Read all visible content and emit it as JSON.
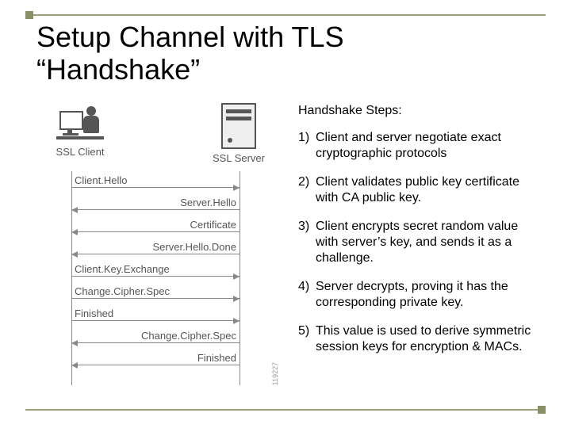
{
  "title_line1": "Setup Channel with TLS",
  "title_line2": "“Handshake”",
  "diagram": {
    "client_label": "SSL Client",
    "server_label": "SSL Server",
    "side_id": "119227",
    "messages": [
      {
        "dir": "right",
        "label": "Client.Hello"
      },
      {
        "dir": "left",
        "label": "Server.Hello"
      },
      {
        "dir": "left",
        "label": "Certificate"
      },
      {
        "dir": "left",
        "label": "Server.Hello.Done"
      },
      {
        "dir": "right",
        "label": "Client.Key.Exchange"
      },
      {
        "dir": "right",
        "label": "Change.Cipher.Spec"
      },
      {
        "dir": "right",
        "label": "Finished"
      },
      {
        "dir": "left",
        "label": "Change.Cipher.Spec"
      },
      {
        "dir": "left",
        "label": "Finished"
      }
    ]
  },
  "steps_title": "Handshake Steps:",
  "steps": [
    {
      "n": "1)",
      "t": "Client and server negotiate exact cryptographic protocols"
    },
    {
      "n": "2)",
      "t": "Client validates public key certificate with CA public key."
    },
    {
      "n": "3)",
      "t": "Client encrypts secret random value with server’s key, and sends it as a challenge."
    },
    {
      "n": "4)",
      "t": "Server decrypts, proving it has the corresponding private key."
    },
    {
      "n": "5)",
      "t": "This value is used to derive symmetric session keys for encryption & MACs."
    }
  ]
}
